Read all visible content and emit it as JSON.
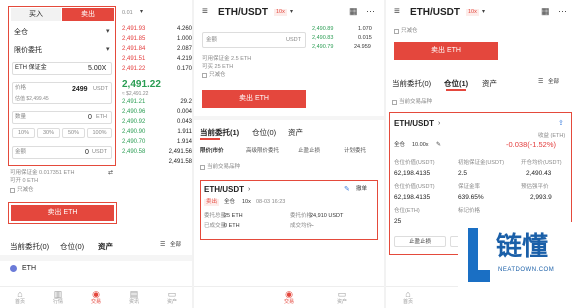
{
  "panel1": {
    "buy_label": "买入",
    "sell_label": "卖出",
    "price_label": "0.01",
    "margin_mode": "全仓",
    "order_type": "限价委托",
    "asset": "ETH 保证金",
    "leverage": "5.00X",
    "price_field_label": "价格",
    "price_value": "2499",
    "price_unit": "USDT",
    "price_est": "估值 $2,499.45",
    "qty_label": "数量",
    "qty_value": "0",
    "qty_unit": "ETH",
    "pcts": [
      "10%",
      "30%",
      "50%",
      "100%"
    ],
    "amount_label": "金额",
    "amount_value": "0",
    "amount_unit": "USDT",
    "available": "可用保证金 0.017351 ETH",
    "available2": "可开 0 ETH",
    "reduce_only": "只减仓",
    "sell_button": "卖出 ETH",
    "orderbook_sells": [
      {
        "p": "2,491.93",
        "q": "4.260"
      },
      {
        "p": "2,491.85",
        "q": "1.000"
      },
      {
        "p": "2,491.84",
        "q": "2.087"
      },
      {
        "p": "2,491.51",
        "q": "4.219"
      },
      {
        "p": "2,491.22",
        "q": "0.170"
      }
    ],
    "last_price": "2,491.22",
    "last_sub": "≈ $2,491.22",
    "orderbook_buys": [
      {
        "p": "2,491.21",
        "q": "29.2"
      },
      {
        "p": "2,490.96",
        "q": "0.004"
      },
      {
        "p": "2,490.92",
        "q": "0.043"
      },
      {
        "p": "2,490.90",
        "q": "1.911"
      },
      {
        "p": "2,490.70",
        "q": "1.914"
      },
      {
        "p": "2,490.58",
        "q": "2,491.56"
      },
      {
        "p": "",
        "q": "2,491.58"
      }
    ],
    "bottom_tabs": {
      "orders": "当前委托(0)",
      "positions": "仓位(0)",
      "assets": "资产",
      "all": "全部"
    },
    "asset_row": "ETH"
  },
  "panel2": {
    "title": "ETH/USDT",
    "badge": "10x",
    "amount_label": "金额",
    "amount_unit": "USDT",
    "ob": [
      {
        "p": "2,490.89",
        "q": "1.070"
      },
      {
        "p": "2,490.83",
        "q": "0.015"
      },
      {
        "p": "2,490.79",
        "q": "24.959"
      }
    ],
    "avail": "可用保证金 2.5 ETH",
    "avail2": "可买 25 ETH",
    "reduce": "只减仓",
    "sell_button": "卖出 ETH",
    "tabs": {
      "orders": "当前委托(1)",
      "positions": "仓位(0)",
      "assets": "资产"
    },
    "subtabs": [
      "限价|市价",
      "高级限价委托",
      "止盈止损",
      "计划委托"
    ],
    "filter": "当前交易品种",
    "order": {
      "pair": "ETH/USDT",
      "edit": "撤单",
      "side": "卖出",
      "mode": "全仓",
      "lev": "10x",
      "time": "08-03 16:23",
      "qty_label": "委托总量",
      "qty_value": "25 ETH",
      "price_label": "委托价格",
      "price_value": "24,910 USDT",
      "filled_label": "已成交量",
      "filled_value": "0 ETH",
      "avg_label": "成交均价",
      "avg_value": "--"
    }
  },
  "panel3": {
    "title": "ETH/USDT",
    "badge": "10x",
    "reduce": "只减仓",
    "sell_button": "卖出 ETH",
    "tabs": {
      "orders": "当前委托(0)",
      "positions": "仓位(1)",
      "assets": "资产",
      "all": "全部"
    },
    "filter": "当前交易品种",
    "pos": {
      "pair": "ETH/USDT",
      "mode": "全仓",
      "lev": "10.00x",
      "pnl_label": "收益 (ETH)",
      "pnl_value": "-0.038(-1.52%)",
      "c1_label": "仓位价值(USDT)",
      "c1_value": "62,198.4135",
      "c2_label": "初始保证金(USDT)",
      "c2_value": "2.5",
      "c3_label": "开仓均价(USDT)",
      "c3_value": "2,490.43",
      "c4_label": "仓位价值(USDT)",
      "c4_value": "62,198.4135",
      "c5_label": "保证金率",
      "c5_value": "639.65%",
      "c6_label": "预估强平价",
      "c6_value": "2,993.9",
      "c7_label": "仓位(ETH)",
      "c7_value": "25",
      "c8_label": "标记价格",
      "c8_value": "",
      "btn1": "止盈止损",
      "btn2": "平仓"
    }
  },
  "tabbar": {
    "home": "首页",
    "market": "行情",
    "trade": "交易",
    "news": "资讯",
    "assets": "资产"
  },
  "watermark": {
    "cn": "链懂",
    "en": "NEATDOWN.COM"
  },
  "colors": {
    "accent": "#e4473d",
    "green": "#2a9d53",
    "red": "#e33b3b"
  }
}
